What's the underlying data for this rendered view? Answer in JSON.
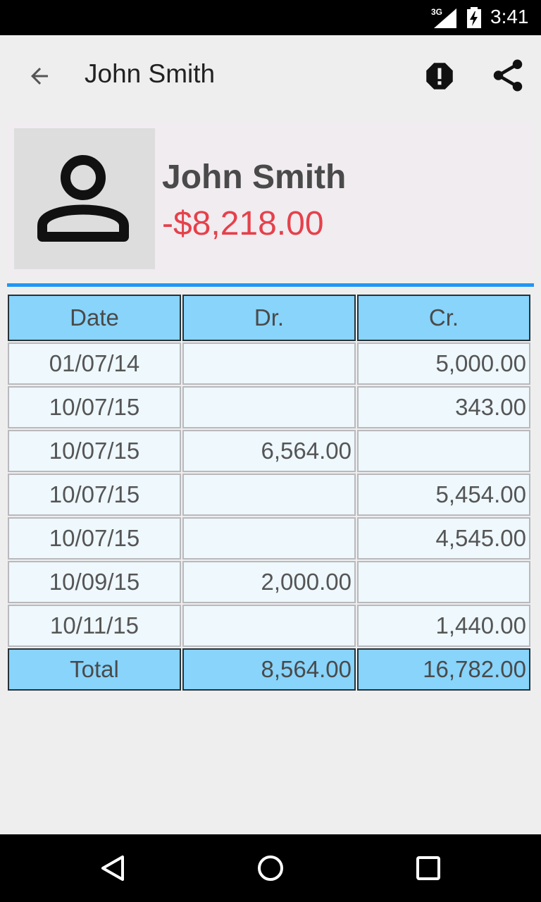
{
  "status_bar": {
    "network": "3G",
    "time": "3:41"
  },
  "app_bar": {
    "title": "John Smith",
    "back_icon": "arrow-back-icon",
    "alert_icon": "alert-octagon-icon",
    "share_icon": "share-icon"
  },
  "profile": {
    "name": "John Smith",
    "balance": "-$8,218.00",
    "balance_color": "#e5414b",
    "avatar_icon": "person-icon"
  },
  "ledger": {
    "headers": {
      "date": "Date",
      "dr": "Dr.",
      "cr": "Cr."
    },
    "rows": [
      {
        "date": "01/07/14",
        "dr": "",
        "cr": "5,000.00"
      },
      {
        "date": "10/07/15",
        "dr": "",
        "cr": "343.00"
      },
      {
        "date": "10/07/15",
        "dr": "6,564.00",
        "cr": ""
      },
      {
        "date": "10/07/15",
        "dr": "",
        "cr": "5,454.00"
      },
      {
        "date": "10/07/15",
        "dr": "",
        "cr": "4,545.00"
      },
      {
        "date": "10/09/15",
        "dr": "2,000.00",
        "cr": ""
      },
      {
        "date": "10/11/15",
        "dr": "",
        "cr": "1,440.00"
      }
    ],
    "total": {
      "label": "Total",
      "dr": "8,564.00",
      "cr": "16,782.00"
    },
    "header_color": "#88d4fb",
    "accent_color": "#2196f3"
  },
  "nav_bar": {
    "back_icon": "nav-back-icon",
    "home_icon": "nav-home-icon",
    "recents_icon": "nav-recents-icon"
  }
}
